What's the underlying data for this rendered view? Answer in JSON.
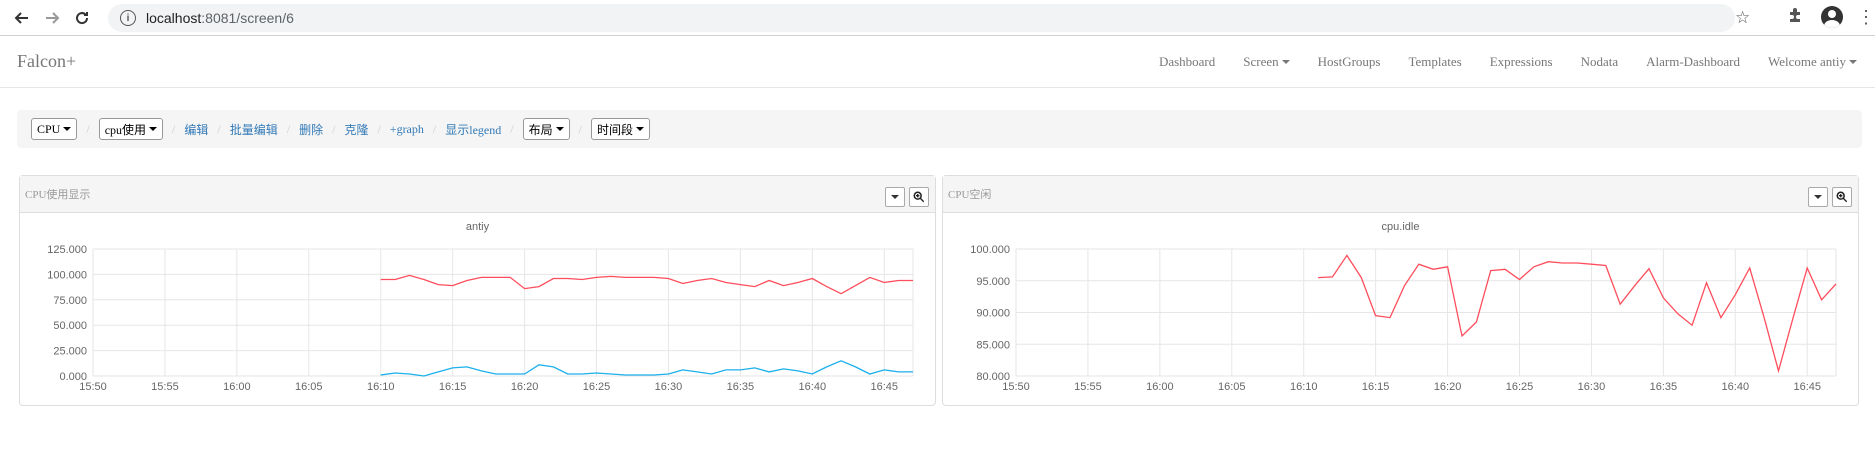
{
  "browser": {
    "url_host": "localhost",
    "url_rest": ":8081/screen/6"
  },
  "navbar": {
    "brand": "Falcon+",
    "items": [
      {
        "label": "Dashboard",
        "dropdown": false
      },
      {
        "label": "Screen",
        "dropdown": true
      },
      {
        "label": "HostGroups",
        "dropdown": false
      },
      {
        "label": "Templates",
        "dropdown": false
      },
      {
        "label": "Expressions",
        "dropdown": false
      },
      {
        "label": "Nodata",
        "dropdown": false
      },
      {
        "label": "Alarm-Dashboard",
        "dropdown": false
      },
      {
        "label": "Welcome antiy",
        "dropdown": true
      }
    ]
  },
  "toolbar": {
    "screen_select": "CPU",
    "subscreen_select": "cpu使用",
    "edit": "编辑",
    "batch_edit": "批量编辑",
    "delete": "删除",
    "clone": "克隆",
    "add_graph": "+graph",
    "show_legend": "显示legend",
    "layout": "布局",
    "time_range": "时间段"
  },
  "panels": [
    {
      "title": "CPU使用显示",
      "subtitle": "antiy"
    },
    {
      "title": "CPU空闲",
      "subtitle": "cpu.idle"
    }
  ],
  "chart_data": [
    {
      "type": "line",
      "subtitle": "antiy",
      "xticks": [
        "15:50",
        "15:55",
        "16:00",
        "16:05",
        "16:10",
        "16:15",
        "16:20",
        "16:25",
        "16:30",
        "16:35",
        "16:40",
        "16:45"
      ],
      "yticks": [
        "125.000",
        "100.000",
        "75.000",
        "50.000",
        "25.000",
        "0.000"
      ],
      "ylim": [
        0,
        125
      ],
      "xlim_minutes": [
        0,
        57
      ],
      "grid": true,
      "colors": [
        "#ff4d5b",
        "#1ab0ec"
      ],
      "series": [
        {
          "x": [
            20,
            21,
            22,
            23,
            24,
            25,
            26,
            27,
            28,
            29,
            30,
            31,
            32,
            33,
            34,
            35,
            36,
            37,
            38,
            39,
            40,
            41,
            42,
            43,
            44,
            45,
            46,
            47,
            48,
            49,
            50,
            51,
            52,
            53,
            54,
            55,
            56,
            57
          ],
          "values": [
            95,
            95,
            99,
            95,
            90,
            89,
            94,
            97,
            97,
            97,
            86,
            88,
            96,
            96,
            95,
            97,
            98,
            97,
            97,
            97,
            96,
            91,
            94,
            96,
            92,
            90,
            88,
            94,
            89,
            92,
            96,
            88,
            81,
            89,
            97,
            92,
            94,
            94
          ]
        },
        {
          "x": [
            20,
            21,
            22,
            23,
            24,
            25,
            26,
            27,
            28,
            29,
            30,
            31,
            32,
            33,
            34,
            35,
            36,
            37,
            38,
            39,
            40,
            41,
            42,
            43,
            44,
            45,
            46,
            47,
            48,
            49,
            50,
            51,
            52,
            53,
            54,
            55,
            56,
            57
          ],
          "values": [
            1,
            3,
            2,
            0,
            4,
            8,
            9,
            5,
            2,
            2,
            2,
            11,
            9,
            2,
            2,
            3,
            2,
            1,
            1,
            1,
            2,
            6,
            4,
            2,
            6,
            6,
            8,
            4,
            7,
            5,
            2,
            9,
            15,
            9,
            2,
            6,
            4,
            4
          ]
        }
      ]
    },
    {
      "type": "line",
      "subtitle": "cpu.idle",
      "xticks": [
        "15:50",
        "15:55",
        "16:00",
        "16:05",
        "16:10",
        "16:15",
        "16:20",
        "16:25",
        "16:30",
        "16:35",
        "16:40",
        "16:45"
      ],
      "yticks": [
        "100.000",
        "95.000",
        "90.000",
        "85.000",
        "80.000"
      ],
      "ylim": [
        80,
        100
      ],
      "xlim_minutes": [
        0,
        57
      ],
      "grid": true,
      "colors": [
        "#ff4d5b"
      ],
      "series": [
        {
          "x": [
            21,
            22,
            23,
            24,
            25,
            26,
            27,
            28,
            29,
            30,
            31,
            32,
            33,
            34,
            35,
            36,
            37,
            38,
            39,
            40,
            41,
            42,
            43,
            44,
            45,
            46,
            47,
            48,
            49,
            50,
            51,
            52,
            53,
            54,
            55,
            56,
            57
          ],
          "values": [
            95.5,
            95.6,
            99,
            95.5,
            89.5,
            89.2,
            94.2,
            97.6,
            96.8,
            97.2,
            86.3,
            88.5,
            96.6,
            96.8,
            95.2,
            97.2,
            98,
            97.8,
            97.8,
            97.6,
            97.4,
            91.3,
            94.2,
            96.9,
            92.3,
            89.8,
            88,
            94.7,
            89.2,
            92.8,
            97,
            89.2,
            80.8,
            89,
            97,
            92,
            94.5
          ]
        }
      ]
    }
  ]
}
